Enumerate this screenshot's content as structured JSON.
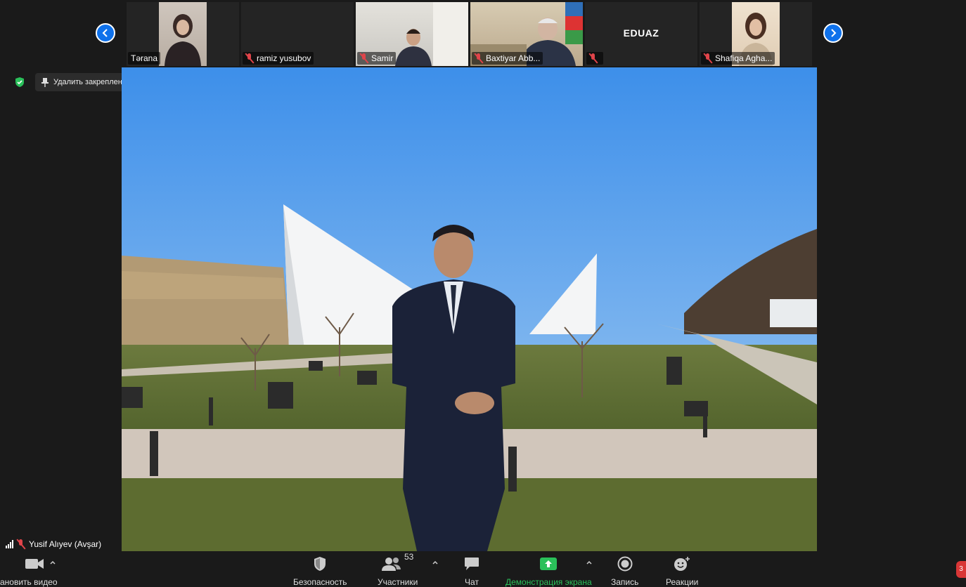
{
  "participants": [
    {
      "name": "Tərana",
      "muted": false
    },
    {
      "name": "ramiz yusubov",
      "muted": true
    },
    {
      "name": "Samir",
      "muted": true
    },
    {
      "name": "Baxtiyar Abb...",
      "muted": true
    },
    {
      "name": "",
      "display": "EDUAZ",
      "muted": true
    },
    {
      "name": "Shafiqa Agha...",
      "muted": true
    }
  ],
  "pin": {
    "unpin_label": "Удалить закрепление"
  },
  "speaker": {
    "name": "Yusif Alıyev (Avşar)"
  },
  "toolbar": {
    "video_label": "ановить видео",
    "security_label": "Безопасность",
    "participants_label": "Участники",
    "participants_count": "53",
    "chat_label": "Чат",
    "share_label": "Демонстрация экрана",
    "record_label": "Запись",
    "reactions_label": "Реакции",
    "badge": "3"
  },
  "colors": {
    "accent": "#0e71eb",
    "muted": "#e0444a",
    "share": "#2ac05a",
    "background": "#1a1a1a"
  },
  "icons": [
    "chevron-left-icon",
    "chevron-right-icon",
    "shield-check-icon",
    "pin-icon",
    "camera-icon",
    "security-shield-icon",
    "participants-icon",
    "chat-icon",
    "share-screen-icon",
    "record-icon",
    "reactions-icon"
  ]
}
